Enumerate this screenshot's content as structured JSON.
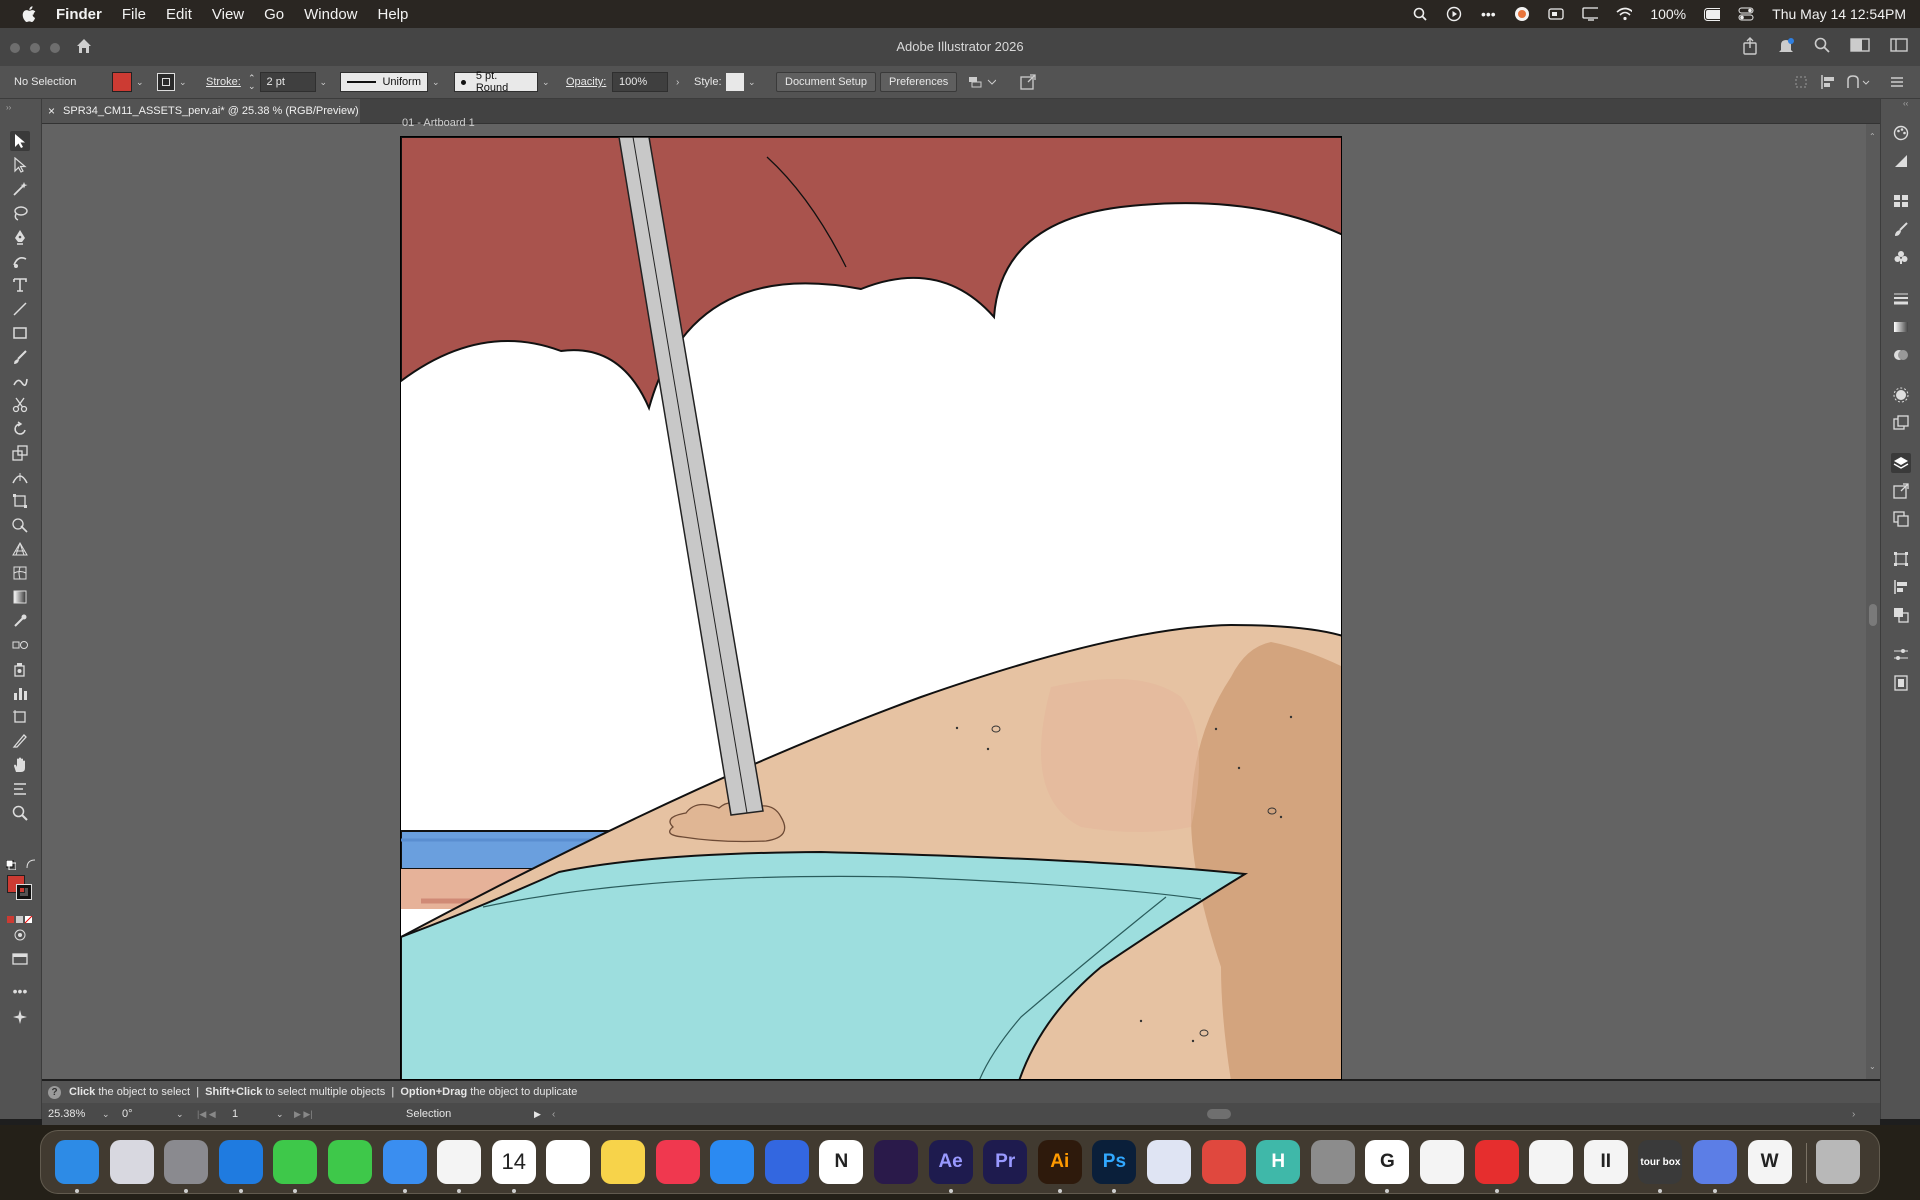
{
  "menubar": {
    "app_name": "Finder",
    "menus": [
      "File",
      "Edit",
      "View",
      "Go",
      "Window",
      "Help"
    ],
    "battery": "100%",
    "clock": "Thu May 14  12:54PM"
  },
  "window": {
    "title": "Adobe Illustrator 2026"
  },
  "controlbar": {
    "selection_label": "No Selection",
    "fill_color": "#cc3b33",
    "stroke_label": "Stroke:",
    "stroke_value": "2 pt",
    "stroke_profile": "Uniform",
    "brush": "5 pt. Round",
    "opacity_label": "Opacity:",
    "opacity_value": "100%",
    "style_label": "Style:",
    "document_setup": "Document Setup",
    "preferences": "Preferences"
  },
  "tab": {
    "close": "×",
    "title": "SPR34_CM11_ASSETS_perv.ai* @ 25.38 % (RGB/Preview)"
  },
  "artboard": {
    "label": "01 - Artboard 1",
    "colors": {
      "umbrella_red": "#a9534d",
      "sand": "#e6c2a2",
      "sand_dark": "#d3a47e",
      "towel": "#9ddede",
      "water": "#6a9fde",
      "pole": "#c8c8c8"
    }
  },
  "hint": {
    "icon": "?",
    "click": "Click",
    "click_text": " the object to select  |  ",
    "shift_click": "Shift+Click",
    "shift_text": " to select multiple objects  |  ",
    "option_drag": "Option+Drag",
    "option_text": " the object to duplicate"
  },
  "status": {
    "zoom": "25.38%",
    "rotation": "0°",
    "artboard_number": "1",
    "tool": "Selection"
  },
  "dock": {
    "apps": [
      {
        "name": "finder",
        "label": "",
        "color": "#2d8be6"
      },
      {
        "name": "launchpad",
        "label": "",
        "color": "#d8d8e0"
      },
      {
        "name": "system-settings",
        "label": "",
        "color": "#8a8a8f"
      },
      {
        "name": "safari",
        "label": "",
        "color": "#1f7be0"
      },
      {
        "name": "messages",
        "label": "",
        "color": "#3ec84a"
      },
      {
        "name": "facetime",
        "label": "",
        "color": "#3ec84a"
      },
      {
        "name": "mail",
        "label": "",
        "color": "#3a8ef0"
      },
      {
        "name": "photos",
        "label": "",
        "color": "#f4f4f4"
      },
      {
        "name": "calendar",
        "label": "14",
        "color": "#ffffff"
      },
      {
        "name": "reminders",
        "label": "",
        "color": "#ffffff"
      },
      {
        "name": "notes",
        "label": "",
        "color": "#f7d34a"
      },
      {
        "name": "music",
        "label": "",
        "color": "#f0384f"
      },
      {
        "name": "app-store",
        "label": "",
        "color": "#2b8af2"
      },
      {
        "name": "tasks",
        "label": "",
        "color": "#3367e0"
      },
      {
        "name": "notion",
        "label": "N",
        "color": "#ffffff"
      },
      {
        "name": "activity",
        "label": "",
        "color": "#2a1a4a"
      },
      {
        "name": "after-effects",
        "label": "Ae",
        "color": "#1e1b4e"
      },
      {
        "name": "premiere-pro",
        "label": "Pr",
        "color": "#1e1b4e"
      },
      {
        "name": "illustrator",
        "label": "Ai",
        "color": "#2e1a0c"
      },
      {
        "name": "photoshop",
        "label": "Ps",
        "color": "#0a1f3a"
      },
      {
        "name": "media-encoder",
        "label": "",
        "color": "#dfe4f3"
      },
      {
        "name": "red-app",
        "label": "",
        "color": "#e0483e"
      },
      {
        "name": "h-app",
        "label": "H",
        "color": "#3fb8a9"
      },
      {
        "name": "lock-app",
        "label": "",
        "color": "#8c8c8c"
      },
      {
        "name": "chrome",
        "label": "G",
        "color": "#ffffff"
      },
      {
        "name": "stocks",
        "label": "",
        "color": "#f4f4f4"
      },
      {
        "name": "youtube",
        "label": "",
        "color": "#e62e2e"
      },
      {
        "name": "squarespace",
        "label": "",
        "color": "#f4f4f4"
      },
      {
        "name": "pause-app",
        "label": "II",
        "color": "#f4f4f4"
      },
      {
        "name": "tourbox",
        "label": "tour box",
        "color": "#3a3a3a"
      },
      {
        "name": "remote",
        "label": "",
        "color": "#5c7ee6"
      },
      {
        "name": "webex",
        "label": "W",
        "color": "#f4f4f4"
      },
      {
        "name": "trash",
        "label": "",
        "color": "#b8b8b8"
      }
    ]
  }
}
